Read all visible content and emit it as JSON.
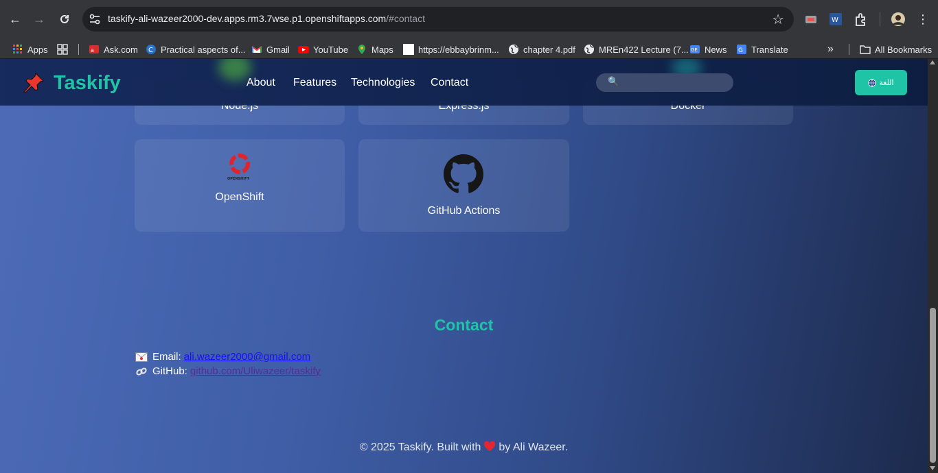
{
  "browser": {
    "url_host": "taskify-ali-wazeer2000-dev.apps.rm3.7wse.p1.openshiftapps.com",
    "url_path": "/#contact",
    "bookmarks": [
      {
        "label": "Apps"
      },
      {
        "label": ""
      },
      {
        "label": "Ask.com"
      },
      {
        "label": "Practical aspects of..."
      },
      {
        "label": "Gmail"
      },
      {
        "label": "YouTube"
      },
      {
        "label": "Maps"
      },
      {
        "label": "https://ebbaybrinm..."
      },
      {
        "label": "chapter 4.pdf"
      },
      {
        "label": "MREn422 Lecture (7..."
      },
      {
        "label": "News"
      },
      {
        "label": "Translate"
      }
    ],
    "more_bookmarks": "»",
    "all_bookmarks": "All Bookmarks"
  },
  "site": {
    "brand": "Taskify",
    "nav": [
      "About",
      "Features",
      "Technologies",
      "Contact"
    ],
    "search_placeholder": "",
    "lang_label": "اللغة",
    "tech_cards_partial": [
      "Node.js",
      "Express.js",
      "Docker"
    ],
    "tech_cards": [
      "OpenShift",
      "GitHub Actions"
    ],
    "openshift_logo_text": "OPENSHIFT",
    "contact": {
      "title": "Contact",
      "email_label": "Email:",
      "email_value": "ali.wazeer2000@gmail.com",
      "github_label": "GitHub:",
      "github_value": "github.com/Uliwazeer/taskify"
    },
    "footer": {
      "prefix": "© 2025 Taskify. Built with",
      "suffix": "by Ali Wazeer."
    }
  },
  "colors": {
    "accent": "#1fc4a6",
    "email_link": "#1a0dff",
    "github_link": "#5b2a93"
  }
}
